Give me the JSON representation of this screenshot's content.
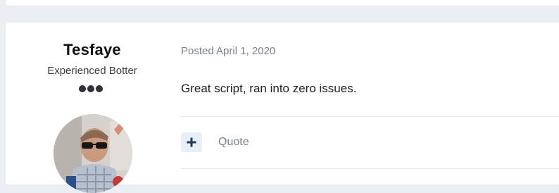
{
  "author": {
    "name": "Tesfaye",
    "rank_title": "Experienced Botter",
    "rank_pips": 3
  },
  "post": {
    "meta": "Posted April 1, 2020",
    "body": "Great script, ran into zero issues."
  },
  "actions": {
    "quote_label": "Quote",
    "plus_icon": "plus-icon"
  },
  "colors": {
    "page_background": "#ebeef2",
    "card_background": "#ffffff",
    "accent_dark_blue": "#1f3b5a",
    "muted_text": "#7a8290"
  }
}
